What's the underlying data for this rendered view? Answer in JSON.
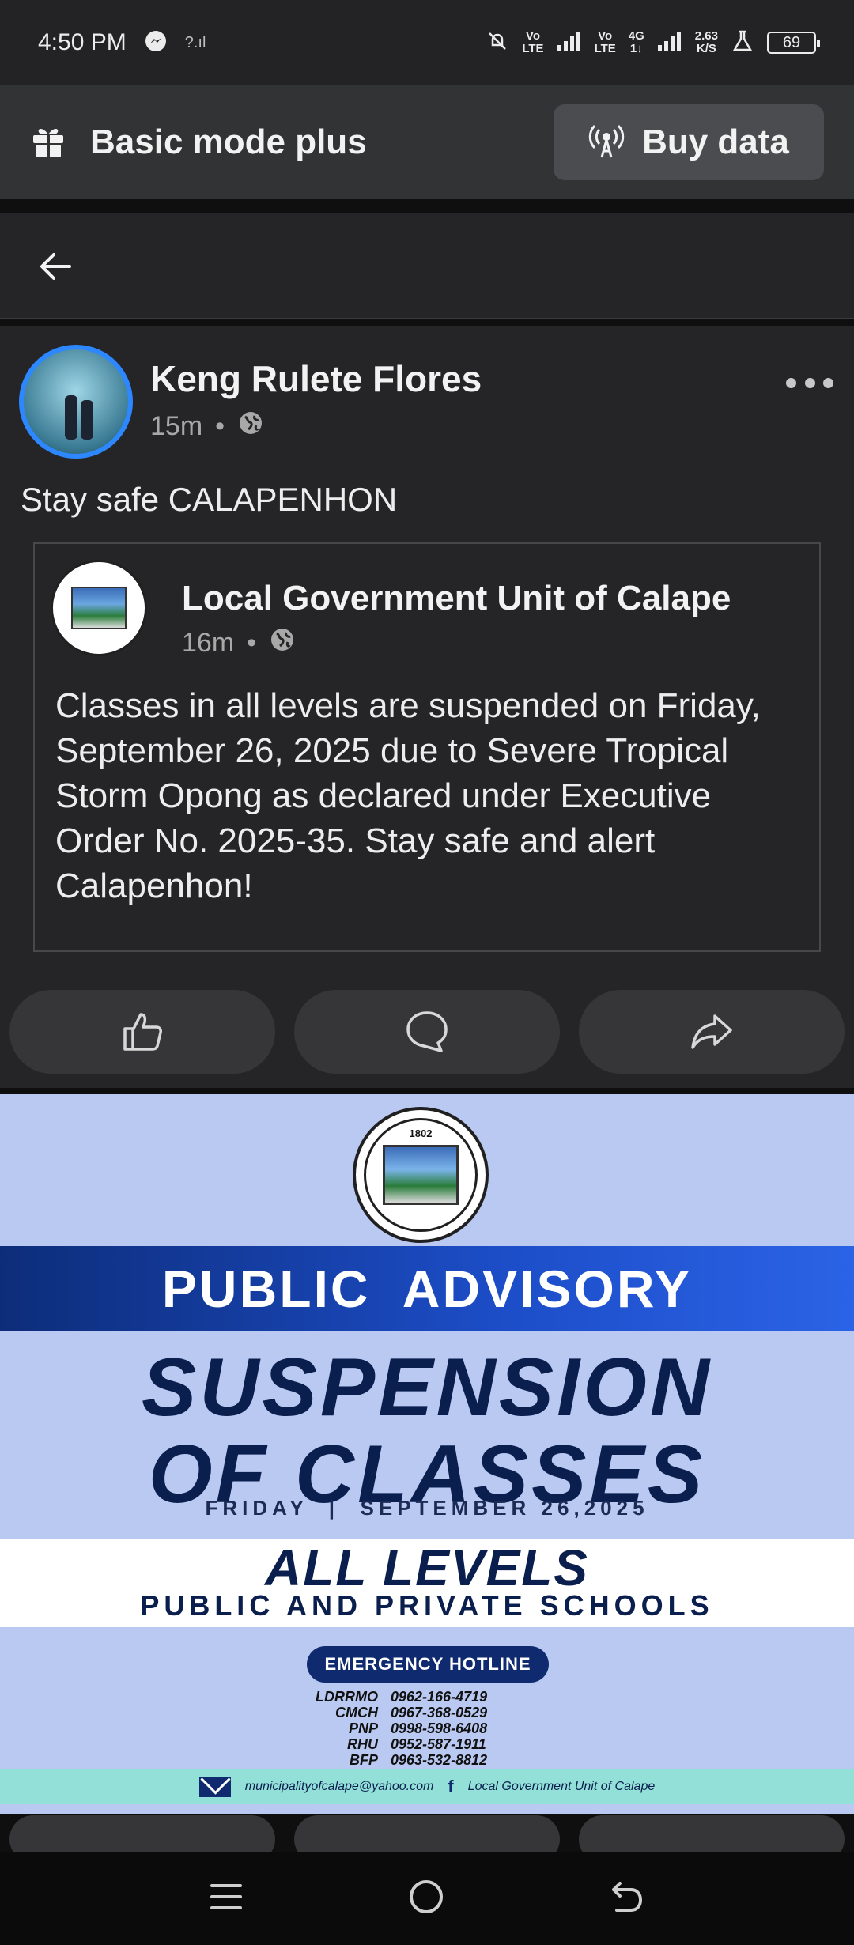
{
  "status_bar": {
    "time": "4:50 PM",
    "signal_left": "?.ıl",
    "volte1_top": "Vo",
    "volte1_bottom": "LTE",
    "volte2_top": "Vo",
    "volte2_bottom": "LTE",
    "net_type_top": "4G",
    "net_type_bottom": "1↓",
    "speed_top": "2.63",
    "speed_bottom": "K/S",
    "battery": "69"
  },
  "mode_bar": {
    "title": "Basic mode plus",
    "buy_label": "Buy data"
  },
  "post": {
    "author": "Keng Rulete Flores",
    "time": "15m",
    "text": "Stay safe CALAPENHON",
    "shared": {
      "page_name": "Local Government Unit of Calape",
      "time": "16m",
      "body": "Classes in all levels are suspended on Friday, September 26, 2025 due to Severe Tropical Storm Opong as declared under Executive Order No. 2025-35. Stay safe and alert Calapenhon!"
    }
  },
  "poster": {
    "seal_year": "1802",
    "band": "PUBLIC  ADVISORY",
    "headline_1": "SUSPENSION",
    "headline_2": "OF CLASSES",
    "date_line": "FRIDAY  |  SEPTEMBER 26,2025",
    "levels": "ALL LEVELS",
    "schools": "PUBLIC AND PRIVATE SCHOOLS",
    "hotline_title": "EMERGENCY HOTLINE",
    "hotlines": [
      {
        "name": "LDRRMO",
        "number": "0962-166-4719"
      },
      {
        "name": "CMCH",
        "number": "0967-368-0529"
      },
      {
        "name": "PNP",
        "number": "0998-598-6408"
      },
      {
        "name": "RHU",
        "number": "0952-587-1911"
      },
      {
        "name": "BFP",
        "number": "0963-532-8812"
      }
    ],
    "email": "municipalityofcalape@yahoo.com",
    "facebook": "Local Government Unit of Calape"
  },
  "colors": {
    "accent_ring": "#2d88ff",
    "poster_bg": "#b9c9f2",
    "poster_navy": "#0b1f4e"
  }
}
